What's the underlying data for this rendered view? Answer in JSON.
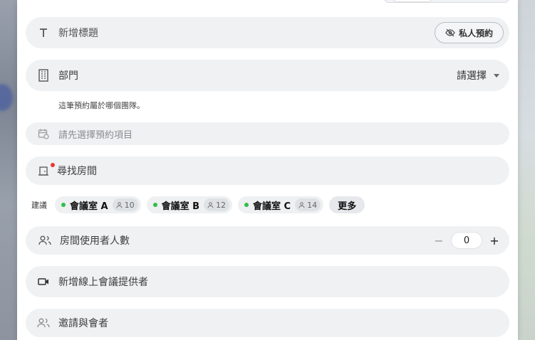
{
  "title": {
    "placeholder": "新增標題",
    "private_button": "私人預約"
  },
  "department": {
    "label": "部門",
    "value": "請選擇",
    "hint": "這筆預約屬於哪個團隊。"
  },
  "booking_item": {
    "placeholder": "請先選擇預約項目"
  },
  "room": {
    "placeholder": "尋找房間"
  },
  "suggestions": {
    "label": "建議",
    "items": [
      {
        "name": "會議室 A",
        "capacity": "10",
        "status_color": "#2fbf4b"
      },
      {
        "name": "會議室 B",
        "capacity": "12",
        "status_color": "#2fbf4b"
      },
      {
        "name": "會議室 C",
        "capacity": "14",
        "status_color": "#2fbf4b"
      }
    ],
    "more": "更多"
  },
  "room_occupancy": {
    "label": "房間使用者人數",
    "value": "0",
    "minus": "−",
    "plus": "+"
  },
  "online_meeting": {
    "label": "新增線上會議提供者"
  },
  "attendees": {
    "label": "邀請與會者"
  }
}
